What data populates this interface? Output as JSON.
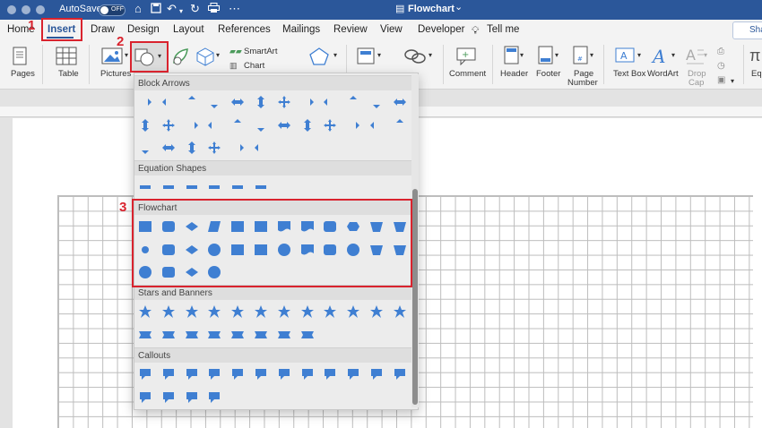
{
  "titlebar": {
    "autosave_label": "AutoSave",
    "autosave_state": "OFF",
    "doc_title": "Flowchart",
    "title_chevron": "⌄"
  },
  "tabs": [
    {
      "label": "Home"
    },
    {
      "label": "Insert"
    },
    {
      "label": "Draw"
    },
    {
      "label": "Design"
    },
    {
      "label": "Layout"
    },
    {
      "label": "References"
    },
    {
      "label": "Mailings"
    },
    {
      "label": "Review"
    },
    {
      "label": "View"
    },
    {
      "label": "Developer"
    },
    {
      "label": "Tell me"
    }
  ],
  "share_label": "Sha",
  "ribbon": {
    "pages": "Pages",
    "table": "Table",
    "pictures": "Pictures",
    "smartart": "SmartArt",
    "chart": "Chart",
    "comment": "Comment",
    "header": "Header",
    "footer": "Footer",
    "page_number_1": "Page",
    "page_number_2": "Number",
    "text_box": "Text Box",
    "wordart": "WordArt",
    "drop_cap_1": "Drop",
    "drop_cap_2": "Cap",
    "equation": "Eq"
  },
  "dropdown": {
    "sections": [
      {
        "title": "Block Arrows",
        "count": 30
      },
      {
        "title": "Equation Shapes",
        "count": 6
      },
      {
        "title": "Flowchart",
        "count": 28
      },
      {
        "title": "Stars and Banners",
        "count": 20
      },
      {
        "title": "Callouts",
        "count": 16
      }
    ]
  },
  "annotations": {
    "step1": "1",
    "step2": "2",
    "step3": "3",
    "color": "#d9232e"
  },
  "colors": {
    "accent": "#2b579a",
    "shape_fill": "#3f7fd2",
    "annotation": "#d9232e"
  }
}
